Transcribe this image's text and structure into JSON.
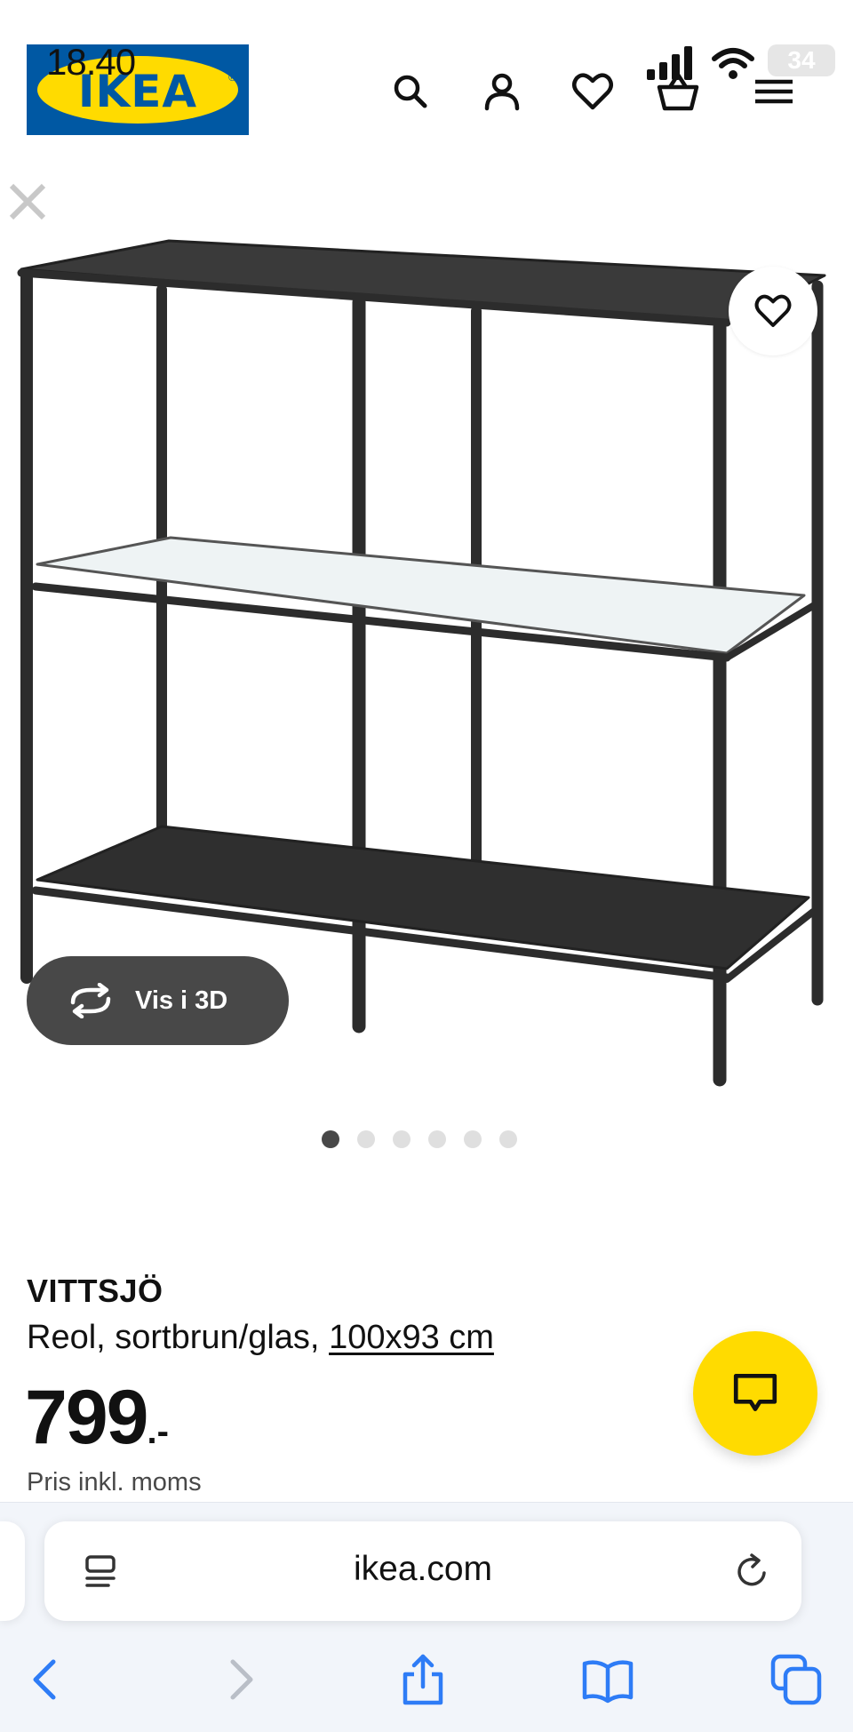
{
  "status_bar": {
    "time": "18.40",
    "battery": "34"
  },
  "header": {
    "logo_text": "IKEA",
    "icons": [
      "search-icon",
      "account-icon",
      "heart-icon",
      "basket-icon",
      "menu-icon"
    ]
  },
  "gallery": {
    "view_3d_label": "Vis i 3D",
    "image_count": 6,
    "active_index": 0
  },
  "product": {
    "name": "VITTSJÖ",
    "description": "Reol, sortbrun/glas,",
    "dimensions": "100x93 cm",
    "price": "799",
    "price_suffix": ".-",
    "price_note": "Pris inkl. moms"
  },
  "browser": {
    "url": "ikea.com"
  },
  "colors": {
    "ikea_blue": "#0058a3",
    "ikea_yellow": "#ffdb00",
    "button_dark": "#484848",
    "ios_blue": "#2e7cf6"
  }
}
